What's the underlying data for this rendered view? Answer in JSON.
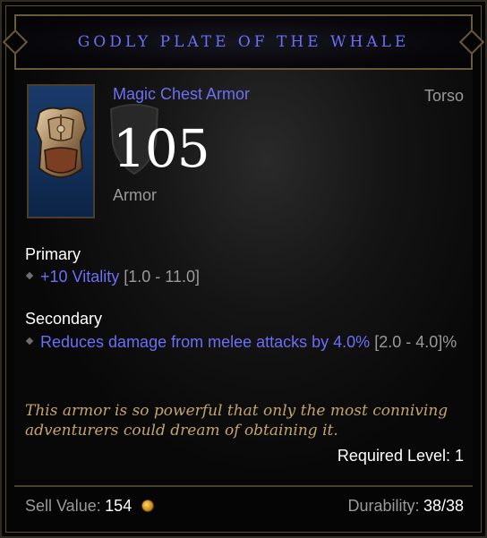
{
  "item": {
    "name": "GODLY PLATE OF THE WHALE",
    "type": "Magic Chest Armor",
    "slot": "Torso",
    "armor_value": "105",
    "armor_label": "Armor"
  },
  "primary": {
    "title": "Primary",
    "affixes": [
      {
        "text": "+10 Vitality",
        "range": "[1.0 - 11.0]"
      }
    ]
  },
  "secondary": {
    "title": "Secondary",
    "affixes": [
      {
        "text": "Reduces damage from melee attacks by 4.0%",
        "range": "[2.0 - 4.0]%"
      }
    ]
  },
  "flavor_text": "This armor is so powerful that only the most conniving adventurers could dream of obtaining it.",
  "required_level": "Required Level: 1",
  "footer": {
    "sell_label": "Sell Value:",
    "sell_value": "154",
    "durability_label": "Durability:",
    "durability_value": "38/38"
  },
  "icons": {
    "item_icon": "chest-armor-icon",
    "currency_icon": "gold-coin-icon"
  },
  "colors": {
    "magic": "#6b6ff5",
    "flavor": "#c3a56a",
    "muted": "#9a9a9a"
  }
}
